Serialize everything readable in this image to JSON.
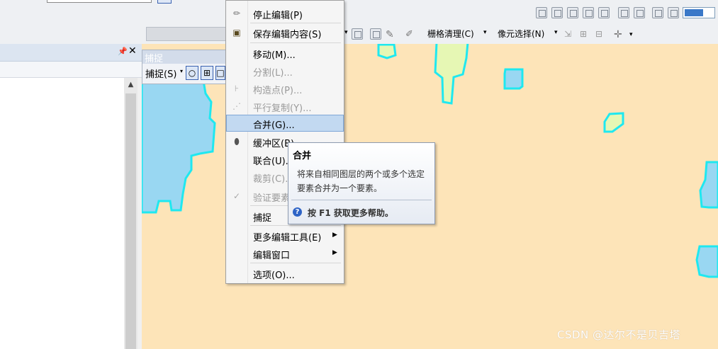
{
  "context_menu": {
    "items": [
      {
        "id": "stop-edit",
        "label": "停止编辑(P)",
        "disabled": false,
        "icon": "pencil-stop-icon"
      },
      {
        "id": "save-edits",
        "label": "保存编辑内容(S)",
        "disabled": false,
        "icon": "save-icon"
      },
      {
        "id": "move",
        "label": "移动(M)...",
        "disabled": false
      },
      {
        "id": "split",
        "label": "分割(L)...",
        "disabled": true
      },
      {
        "id": "construct-points",
        "label": "构造点(P)...",
        "disabled": true,
        "icon": "construct-points-icon"
      },
      {
        "id": "copy-parallel",
        "label": "平行复制(Y)...",
        "disabled": true,
        "icon": "copy-parallel-icon"
      },
      {
        "id": "merge",
        "label": "合并(G)...",
        "disabled": false,
        "highlighted": true
      },
      {
        "id": "buffer",
        "label": "缓冲区(B)",
        "disabled": false,
        "icon": "buffer-icon"
      },
      {
        "id": "union",
        "label": "联合(U)...",
        "disabled": false
      },
      {
        "id": "clip",
        "label": "裁剪(C)...",
        "disabled": true
      },
      {
        "id": "validate",
        "label": "验证要素",
        "disabled": true,
        "icon": "validate-icon"
      },
      {
        "id": "snapping",
        "label": "捕捉",
        "disabled": false,
        "submenu": true
      },
      {
        "id": "more-tools",
        "label": "更多编辑工具(E)",
        "disabled": false,
        "submenu": true
      },
      {
        "id": "edit-windows",
        "label": "编辑窗口",
        "disabled": false,
        "submenu": true
      },
      {
        "id": "options",
        "label": "选项(O)...",
        "disabled": false
      }
    ]
  },
  "tooltip": {
    "title": "合并",
    "body": "将来自相同图层的两个或多个选定要素合并为一个要素。",
    "help": "按 F1 获取更多帮助。"
  },
  "snap_toolbar": {
    "title": "捕捉",
    "menu_label": "捕捉(S)"
  },
  "toolbar2": {
    "raster_cleanup": "栅格清理(C)",
    "pixel_select": "像元选择(N)"
  },
  "watermark": "CSDN @达尔不是贝吉塔",
  "colors": {
    "map_background": "#fde4b8",
    "polygon_fill_blue": "#99d7f2",
    "polygon_fill_green": "#e6f7b4",
    "polygon_outline": "#1fe8f0",
    "menu_highlight": "#c2d9f1"
  }
}
